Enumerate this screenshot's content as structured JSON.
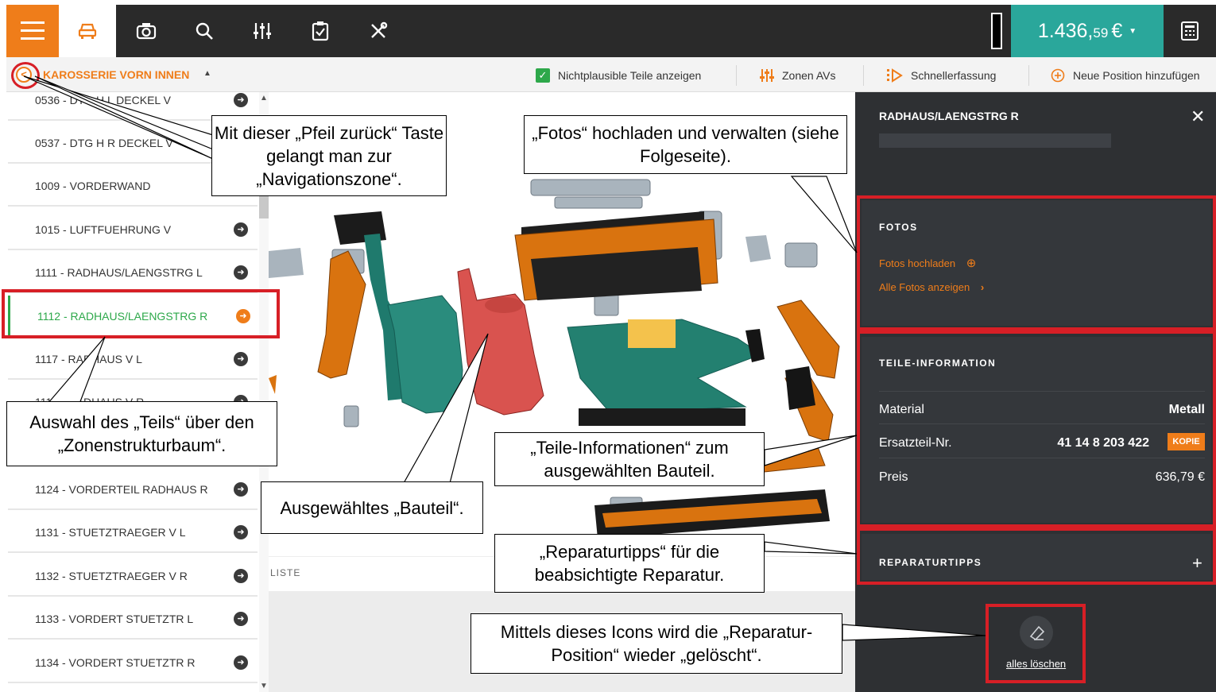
{
  "topbar": {
    "total_main": "1.436,",
    "total_cents": "59",
    "total_currency": "€"
  },
  "subbar": {
    "back_symbol": "<",
    "zone_title": "KAROSSERIE VORN INNEN",
    "checkbox_label": "Nichtplausible Teile anzeigen",
    "zones_label": "Zonen AVs",
    "quick_label": "Schnellerfassung",
    "new_position_label": "Neue Position hinzufügen"
  },
  "tree": {
    "items": [
      {
        "label": "0536 - DTG H L DECKEL V"
      },
      {
        "label": "0537 - DTG H R DECKEL V"
      },
      {
        "label": "1009 - VORDERWAND"
      },
      {
        "label": "1015 - LUFTFUEHRUNG V"
      },
      {
        "label": "1111 - RADHAUS/LAENGSTRG L"
      },
      {
        "label": "1112 - RADHAUS/LAENGSTRG R"
      },
      {
        "label": "1117 - RADHAUS V L"
      },
      {
        "label": "1118 - RADHAUS V R"
      },
      {
        "label": "1124 - VORDERTEIL RADHAUS R"
      },
      {
        "label": "1131 - STUETZTRAEGER V L"
      },
      {
        "label": "1132 - STUETZTRAEGER V R"
      },
      {
        "label": "1133 - VORDERT STUETZTR L"
      },
      {
        "label": "1134 - VORDERT STUETZTR R"
      }
    ]
  },
  "center": {
    "liste_label": "LISTE"
  },
  "panel": {
    "title": "RADHAUS/LAENGSTRG R",
    "fotos": {
      "heading": "FOTOS",
      "upload_label": "Fotos hochladen",
      "show_all_label": "Alle Fotos anzeigen"
    },
    "info": {
      "heading": "TEILE-INFORMATION",
      "material_key": "Material",
      "material_value": "Metall",
      "part_no_key": "Ersatzteil-Nr.",
      "part_no_value": "41 14 8 203 422",
      "copy_badge": "KOPIE",
      "price_key": "Preis",
      "price_value": "636,79 €"
    },
    "tips": {
      "heading": "REPARATURTIPPS",
      "expand_symbol": "+"
    },
    "delete_all_label": "alles löschen"
  },
  "annotations": {
    "back": "Mit dieser „Pfeil zurück“ Taste gelangt man zur „Navigationszone“.",
    "fotos": "„Fotos“ hochladen und verwalten (siehe Folgeseite).",
    "tree": "Auswahl des „Teils“ über den „Zonenstrukturbaum“.",
    "part": "Ausgewähltes „Bauteil“.",
    "info": "„Teile-Informationen“ zum ausgewählten Bauteil.",
    "tips": "„Reparaturtipps“ für die beabsichtigte Reparatur.",
    "delete": "Mittels dieses Icons wird die „Reparatur-Position“ wieder „gelöscht“."
  },
  "colors": {
    "accent_orange": "#ef7d1a",
    "selected_green": "#2da84a",
    "total_teal": "#2aa79b",
    "highlight_red": "#d71f26",
    "panel_dark": "#2e3033"
  }
}
